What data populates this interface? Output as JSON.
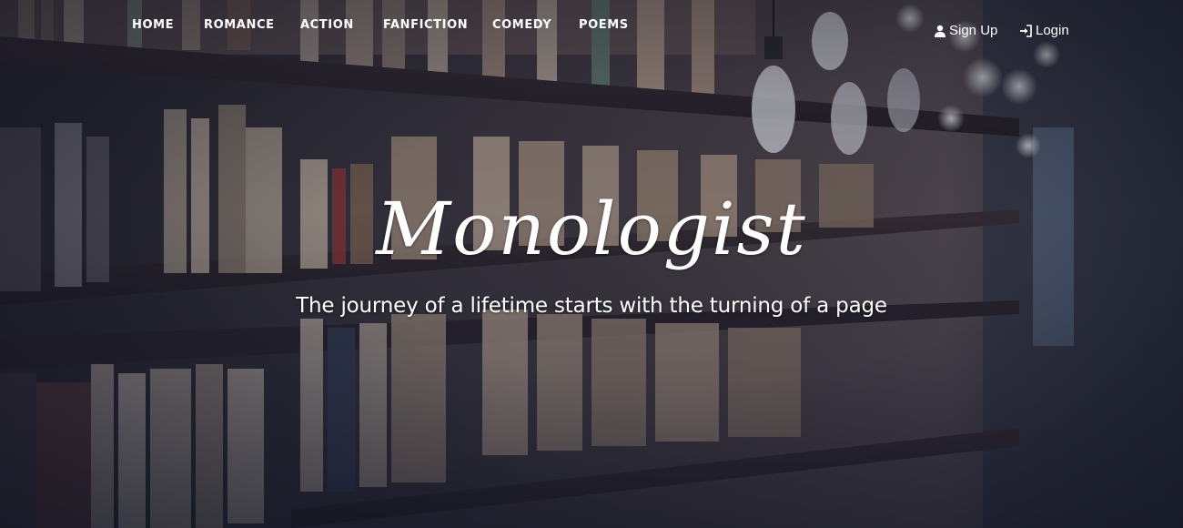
{
  "nav": {
    "items": [
      {
        "label": "HOME"
      },
      {
        "label": "ROMANCE"
      },
      {
        "label": "ACTION"
      },
      {
        "label": "FANFICTION"
      },
      {
        "label": "COMEDY"
      },
      {
        "label": "POEMS"
      }
    ],
    "signup": {
      "label": "Sign Up",
      "icon": "user-icon"
    },
    "login": {
      "label": "Login",
      "icon": "login-icon"
    }
  },
  "hero": {
    "brand": "Monologist",
    "tagline": "The journey of a lifetime starts with the turning of a page",
    "background": "library-bookshelf-photo"
  },
  "colors": {
    "text": "#ffffff",
    "overlay": "#1c1f30"
  }
}
